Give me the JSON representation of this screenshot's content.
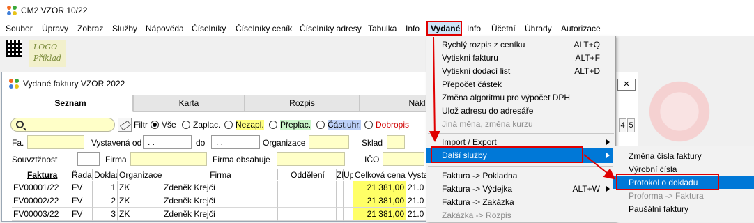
{
  "app": {
    "title": "CM2 VZOR 10/22"
  },
  "menubar": [
    "Soubor",
    "Úpravy",
    "Zobraz",
    "Služby",
    "Nápověda",
    "Číselníky",
    "Číselníky ceník",
    "Číselníky adresy",
    "Tabulka",
    "Info",
    "Vydané",
    "Info",
    "Účetní",
    "Úhrady",
    "Autorizace"
  ],
  "logo": {
    "line1": "LOGO",
    "line2": "Příklad"
  },
  "child": {
    "title": "Vydané faktury VZOR  2022",
    "close": "✕",
    "tabs": [
      "Seznam",
      "Karta",
      "Rozpis",
      "Nákl"
    ],
    "filter_label": "Filtr",
    "radios": [
      "Vše",
      "Zaplac.",
      "Nezapl.",
      "Přeplac.",
      "Část.uhr.",
      "Dobropis"
    ],
    "fields": {
      "fa": "Fa.",
      "vystavena_od": "Vystavená od",
      "date1": ". .",
      "do": "do",
      "date2": ". .",
      "organizace": "Organizace",
      "sklad": "Sklad",
      "souvztaznost": "Souvztžnost",
      "firma": "Firma",
      "firma_obsahuje": "Firma obsahuje",
      "ico": "IČO"
    },
    "nav_buttons": [
      "4",
      "5"
    ],
    "table": {
      "headers": [
        "Faktura",
        "Řada",
        "Doklad",
        "Organizace",
        "Firma",
        "Oddělení",
        "Zl",
        "Up",
        "Celková cena",
        "Vysta"
      ],
      "rows": [
        [
          "FV00001/22",
          "FV",
          "1",
          "ZK",
          "Zdeněk Krejčí",
          "",
          "",
          "",
          "21 381,00",
          "21.0"
        ],
        [
          "FV00002/22",
          "FV",
          "2",
          "ZK",
          "Zdeněk Krejčí",
          "",
          "",
          "",
          "21 381,00",
          "21.0"
        ],
        [
          "FV00003/22",
          "FV",
          "3",
          "ZK",
          "Zdeněk Krejčí",
          "",
          "",
          "",
          "21 381,00",
          "21.0"
        ]
      ]
    }
  },
  "dropdown": {
    "items": [
      {
        "label": "Rychlý rozpis z ceníku",
        "shortcut": "ALT+Q"
      },
      {
        "label": "Vytiskni fakturu",
        "shortcut": "ALT+F"
      },
      {
        "label": "Vytiskni dodací list",
        "shortcut": "ALT+D"
      },
      {
        "label": "Přepočet  částek",
        "shortcut": ""
      },
      {
        "label": "Změna algoritmu pro výpočet DPH",
        "shortcut": ""
      },
      {
        "label": "Ulož adresu do adresáře",
        "shortcut": ""
      },
      {
        "label": "Jiná měna, změna kurzu",
        "shortcut": ""
      },
      {
        "label": "Import / Export",
        "shortcut": ""
      },
      {
        "label": "Další služby",
        "shortcut": ""
      },
      {
        "label": "Faktura -> Pokladna",
        "shortcut": ""
      },
      {
        "label": "Faktura -> Výdejka",
        "shortcut": "ALT+W"
      },
      {
        "label": "Faktura -> Zakázka",
        "shortcut": ""
      },
      {
        "label": "Zakázka -> Rozpis",
        "shortcut": ""
      }
    ]
  },
  "submenu": {
    "items": [
      "Změna čísla faktury",
      "Výrobní čísla",
      "Protokol o dokladu",
      "Proforma -> Faktura",
      "Paušální faktury"
    ]
  },
  "colors": {
    "accent": "#0078d7",
    "highlight_frame": "#e00000",
    "amount_bg": "#ffff66"
  }
}
